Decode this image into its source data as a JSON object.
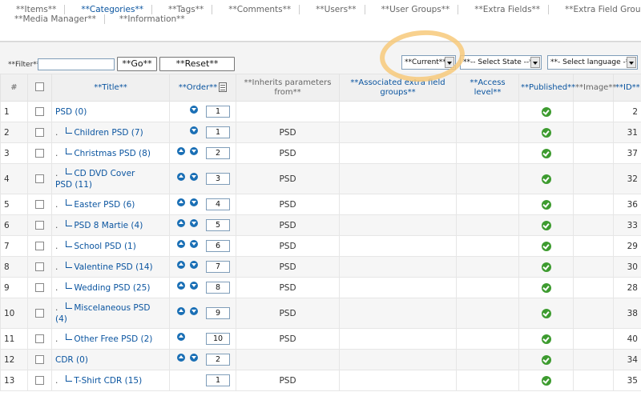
{
  "submenu": {
    "row1": [
      "**Items**",
      "**Categories**",
      "**Tags**",
      "**Comments**",
      "**Users**",
      "**User Groups**",
      "**Extra Fields**",
      "**Extra Field Groups**"
    ],
    "row2": [
      "**Media Manager**",
      "**Information**"
    ],
    "active": "**Categories**"
  },
  "filter": {
    "label": "**Filter**",
    "value": "",
    "go_label": "**Go**",
    "reset_label": "**Reset**",
    "current_select": "**Current**",
    "state_select": "**-- Select State --**",
    "language_select": "**- Select language -**"
  },
  "table": {
    "headers": {
      "num": "#",
      "title": "**Title**",
      "order": "**Order**",
      "inherits": "**Inherits parameters from**",
      "extra_groups": "**Associated extra field groups**",
      "access": "**Access level**",
      "published": "**Published**",
      "image": "**Image**",
      "id": "**ID**"
    },
    "rows": [
      {
        "num": "1",
        "title": "PSD (0)",
        "child": false,
        "order": "1",
        "up": false,
        "down": true,
        "inherits": "",
        "id": "2"
      },
      {
        "num": "2",
        "title": "Children PSD (7)",
        "child": true,
        "order": "1",
        "up": false,
        "down": true,
        "inherits": "PSD",
        "id": "31"
      },
      {
        "num": "3",
        "title": "Christmas PSD (8)",
        "child": true,
        "order": "2",
        "up": true,
        "down": true,
        "inherits": "PSD",
        "id": "37"
      },
      {
        "num": "4",
        "title": "CD DVD Cover PSD (11)",
        "child": true,
        "order": "3",
        "up": true,
        "down": true,
        "inherits": "PSD",
        "id": "32"
      },
      {
        "num": "5",
        "title": "Easter PSD (6)",
        "child": true,
        "order": "4",
        "up": true,
        "down": true,
        "inherits": "PSD",
        "id": "36"
      },
      {
        "num": "6",
        "title": "PSD 8 Martie (4)",
        "child": true,
        "order": "5",
        "up": true,
        "down": true,
        "inherits": "PSD",
        "id": "33"
      },
      {
        "num": "7",
        "title": "School PSD (1)",
        "child": true,
        "order": "6",
        "up": true,
        "down": true,
        "inherits": "PSD",
        "id": "29"
      },
      {
        "num": "8",
        "title": "Valentine PSD (14)",
        "child": true,
        "order": "7",
        "up": true,
        "down": true,
        "inherits": "PSD",
        "id": "30"
      },
      {
        "num": "9",
        "title": "Wedding PSD (25)",
        "child": true,
        "order": "8",
        "up": true,
        "down": true,
        "inherits": "PSD",
        "id": "28"
      },
      {
        "num": "10",
        "title": "Miscelaneous PSD (4)",
        "child": true,
        "order": "9",
        "up": true,
        "down": true,
        "inherits": "PSD",
        "id": "38"
      },
      {
        "num": "11",
        "title": "Other Free PSD (2)",
        "child": true,
        "order": "10",
        "up": true,
        "down": false,
        "inherits": "PSD",
        "id": "40"
      },
      {
        "num": "12",
        "title": "CDR (0)",
        "child": false,
        "order": "2",
        "up": true,
        "down": true,
        "inherits": "",
        "id": "34"
      },
      {
        "num": "13",
        "title": "T-Shirt CDR (15)",
        "child": true,
        "order": "1",
        "up": false,
        "down": false,
        "inherits": "PSD",
        "id": "35"
      }
    ]
  }
}
